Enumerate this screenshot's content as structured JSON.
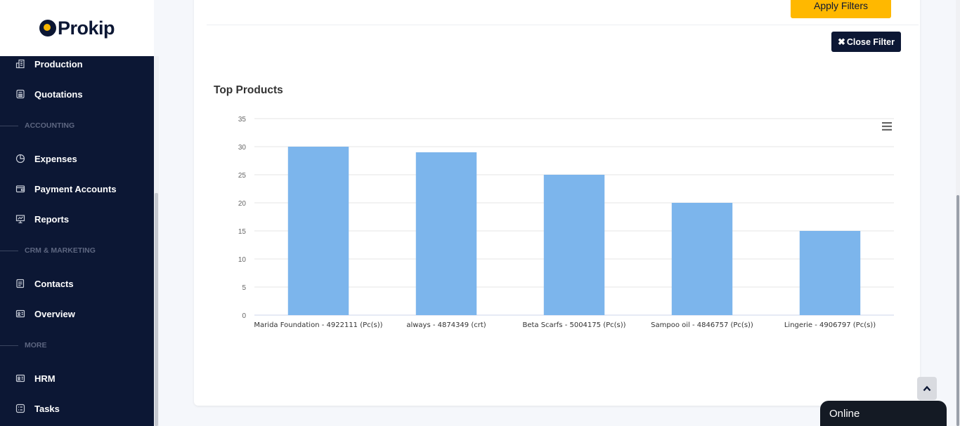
{
  "brand": {
    "name": "Prokip"
  },
  "sidebar": {
    "items": [
      {
        "label": "Production",
        "icon": "building-icon"
      },
      {
        "label": "Quotations",
        "icon": "calculator-icon"
      },
      {
        "section": "ACCOUNTING"
      },
      {
        "label": "Expenses",
        "icon": "pie-icon"
      },
      {
        "label": "Payment Accounts",
        "icon": "wallet-icon"
      },
      {
        "label": "Reports",
        "icon": "presentation-icon"
      },
      {
        "section": "CRM & MARKETING"
      },
      {
        "label": "Contacts",
        "icon": "contacts-icon"
      },
      {
        "label": "Overview",
        "icon": "id-card-icon"
      },
      {
        "section": "MORE"
      },
      {
        "label": "HRM",
        "icon": "id-card-icon"
      },
      {
        "label": "Tasks",
        "icon": "tasks-icon"
      }
    ]
  },
  "filters": {
    "apply_label": "Apply Filters",
    "close_label": "Close Filter"
  },
  "chart_data": {
    "type": "bar",
    "title": "Top Products",
    "categories": [
      "Marida Foundation - 4922111 (Pc(s))",
      "always - 4874349 (crt)",
      "Beta Scarfs - 5004175 (Pc(s))",
      "Sampoo oil - 4846757 (Pc(s))",
      "Lingerie - 4906797 (Pc(s))"
    ],
    "values": [
      30,
      29,
      25,
      20,
      15
    ],
    "ylim": [
      0,
      35
    ],
    "yticks": [
      0,
      5,
      10,
      15,
      20,
      25,
      30,
      35
    ],
    "color": "#7cb5ec",
    "grid": true,
    "legend": "none"
  },
  "status": {
    "online_label": "Online"
  },
  "colors": {
    "sidebar": "#0c1734",
    "accent": "#ffb800",
    "bar": "#7cb5ec"
  }
}
